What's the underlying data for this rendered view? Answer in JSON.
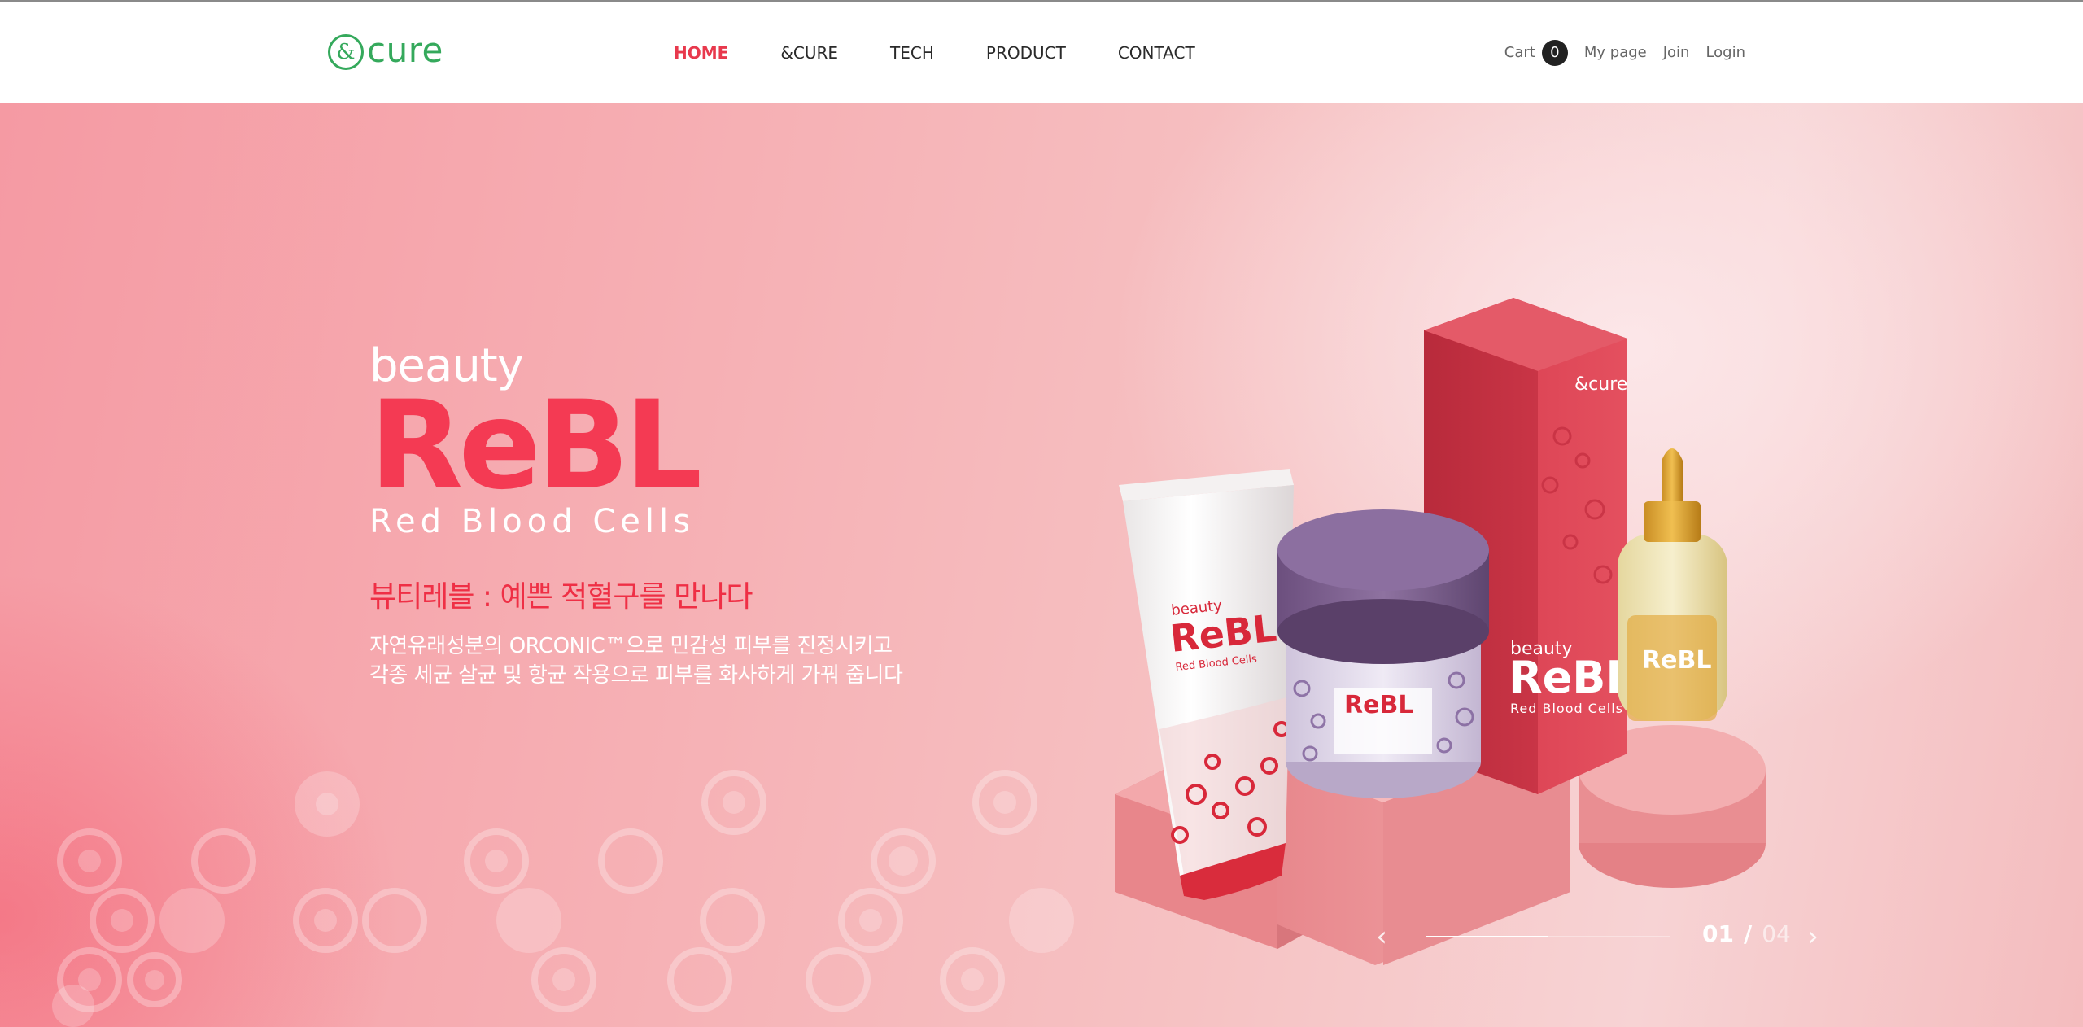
{
  "header": {
    "logo": {
      "mark": "&",
      "text": "cure"
    },
    "nav": [
      {
        "label": "HOME",
        "active": true
      },
      {
        "label": "&CURE",
        "active": false
      },
      {
        "label": "TECH",
        "active": false
      },
      {
        "label": "PRODUCT",
        "active": false
      },
      {
        "label": "CONTACT",
        "active": false
      }
    ],
    "util": {
      "cart_label": "Cart",
      "cart_count": "0",
      "mypage_label": "My page",
      "join_label": "Join",
      "login_label": "Login"
    }
  },
  "hero": {
    "brand_beauty": "beauty",
    "brand_name": "ReBL",
    "brand_sub": "Red Blood Cells",
    "headline": "뷰티레블 : 예쁜 적혈구를 만나다",
    "desc_line1": "자연유래성분의 ORCONIC™으로 민감성 피부를 진정시키고",
    "desc_line2": "각종 세균 살균 및 항균 작용으로 피부를 화사하게 가꿔 줍니다",
    "packaging": {
      "box_logo": "&cure",
      "beauty": "beauty",
      "name": "ReBL",
      "sub": "Red Blood Cells"
    }
  },
  "slider": {
    "current": "01",
    "separator": "/",
    "total": "04",
    "progress": 0.5,
    "prev_icon": "chevron-left-icon",
    "next_icon": "chevron-right-icon"
  },
  "colors": {
    "brand_green": "#35a95c",
    "accent_red": "#e8394d",
    "rebl_red": "#f43a53"
  }
}
